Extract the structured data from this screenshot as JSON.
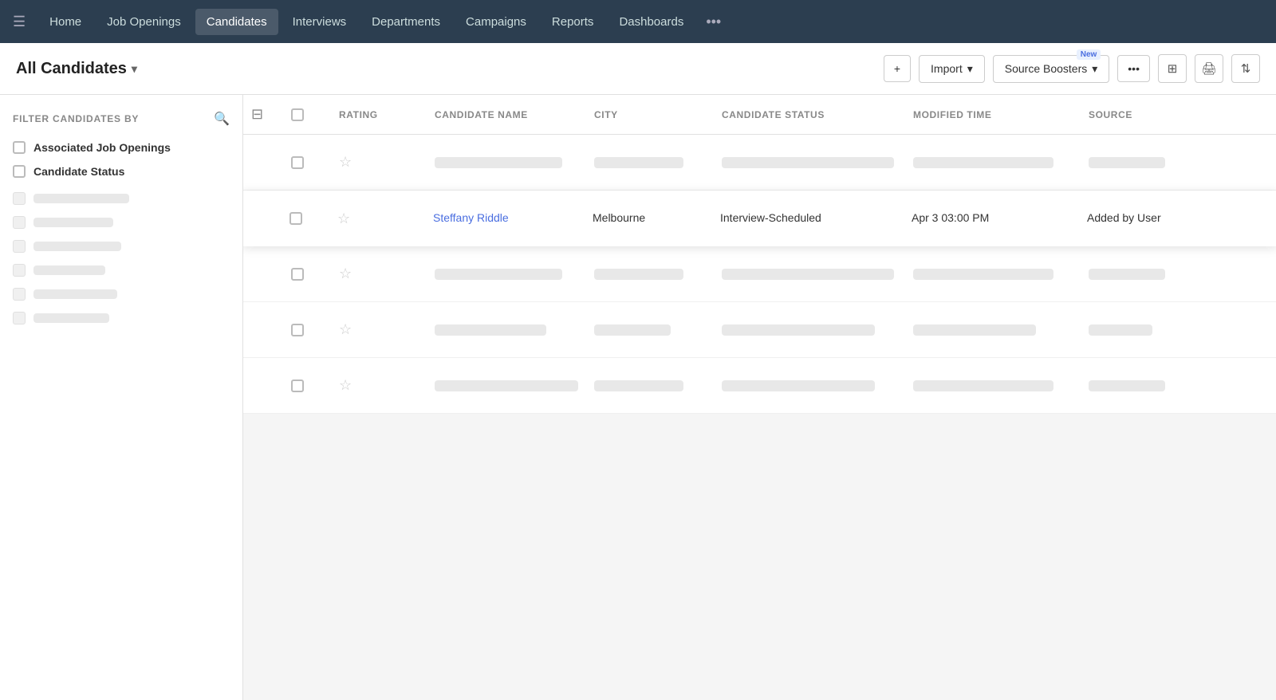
{
  "nav": {
    "hamburger": "☰",
    "items": [
      {
        "label": "Home",
        "active": false
      },
      {
        "label": "Job Openings",
        "active": false
      },
      {
        "label": "Candidates",
        "active": true
      },
      {
        "label": "Interviews",
        "active": false
      },
      {
        "label": "Departments",
        "active": false
      },
      {
        "label": "Campaigns",
        "active": false
      },
      {
        "label": "Reports",
        "active": false
      },
      {
        "label": "Dashboards",
        "active": false
      }
    ],
    "more": "•••"
  },
  "toolbar": {
    "title": "All Candidates",
    "add_label": "+",
    "import_label": "Import",
    "source_boosters_label": "Source Boosters",
    "new_badge": "New",
    "more_label": "•••"
  },
  "sidebar": {
    "filter_title": "FILTER CANDIDATES BY",
    "filters": [
      {
        "label": "Associated Job Openings"
      },
      {
        "label": "Candidate Status"
      }
    ],
    "skeleton_widths": [
      120,
      100,
      110,
      90,
      105,
      95
    ]
  },
  "table": {
    "columns": [
      "",
      "RATING",
      "CANDIDATE NAME",
      "CITY",
      "CANDIDATE STATUS",
      "MODIFIED TIME",
      "SOURCE"
    ],
    "highlighted_row": {
      "candidate_name": "Steffany Riddle",
      "city": "Melbourne",
      "status": "Interview-Scheduled",
      "modified_time": "Apr 3 03:00 PM",
      "source": "Added by User"
    }
  }
}
